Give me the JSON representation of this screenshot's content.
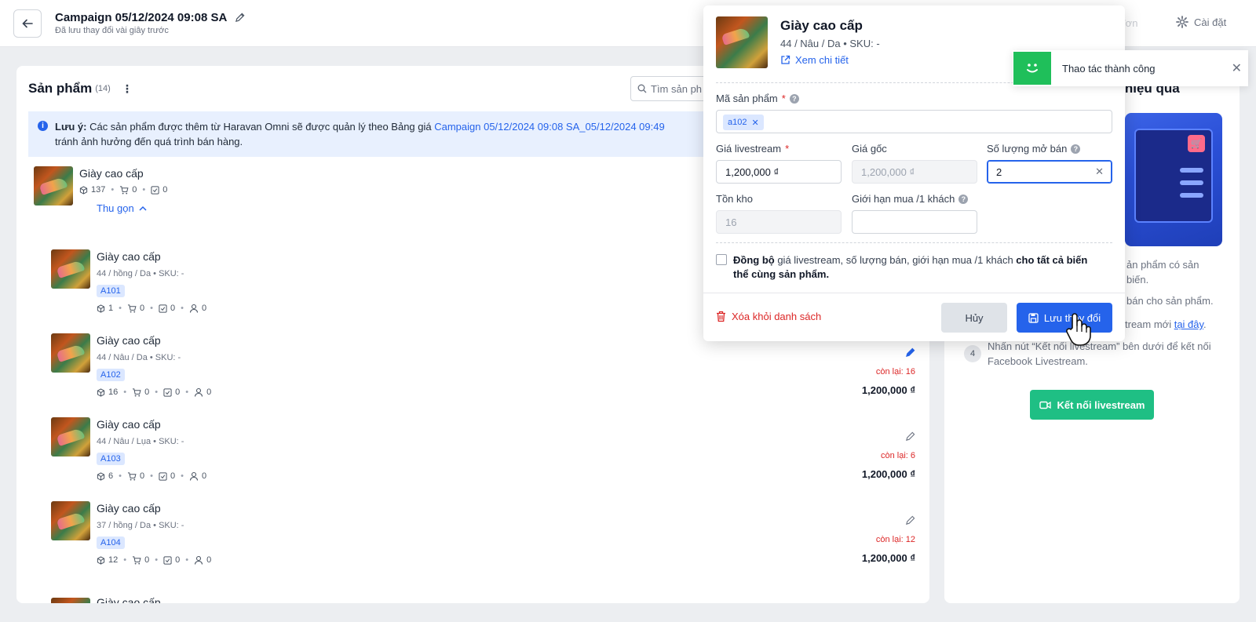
{
  "header": {
    "title": "Campaign 05/12/2024 09:08 SA",
    "subtitle": "Đã lưu thay đổi vài giây trước",
    "faded_action": "ết đơn",
    "settings_label": "Cài đặt"
  },
  "products_panel": {
    "title": "Sản phẩm",
    "count": "(14)",
    "search_placeholder": "Tìm sản ph",
    "notice": {
      "label": "Lưu ý:",
      "text": " Các sản phẩm được thêm từ Haravan Omni sẽ được quản lý theo Bảng giá ",
      "campaign_link": "Campaign 05/12/2024 09:08 SA_05/12/2024 09:49",
      "text2": "tránh ảnh hưởng đến quá trình bán hàng."
    },
    "parent": {
      "name": "Giày cao cấp",
      "stock": "137",
      "cart": "0",
      "ordered": "0",
      "collapse_label": "Thu gọn"
    },
    "variants": [
      {
        "name": "Giày cao cấp",
        "variant": "44 / hồng / Da • SKU: -",
        "tag": "A101",
        "stock": "1",
        "cart": "0",
        "ordered": "0",
        "buyers": "0",
        "remain": "",
        "price": ""
      },
      {
        "name": "Giày cao cấp",
        "variant": "44 / Nâu / Da • SKU: -",
        "tag": "A102",
        "stock": "16",
        "cart": "0",
        "ordered": "0",
        "buyers": "0",
        "remain": "còn lại: 16",
        "price": "1,200,000 ₫"
      },
      {
        "name": "Giày cao cấp",
        "variant": "44 / Nâu / Lụa • SKU: -",
        "tag": "A103",
        "stock": "6",
        "cart": "0",
        "ordered": "0",
        "buyers": "0",
        "remain": "còn lại: 6",
        "price": "1,200,000 ₫"
      },
      {
        "name": "Giày cao cấp",
        "variant": "37 / hồng / Da • SKU: -",
        "tag": "A104",
        "stock": "12",
        "cart": "0",
        "ordered": "0",
        "buyers": "0",
        "remain": "còn lại: 12",
        "price": "1,200,000 ₫"
      }
    ],
    "partial_next": "Giày cao cấp"
  },
  "guide": {
    "title": "m hiệu qua",
    "line1": "ản phẩm có sản",
    "line1b": "biến.",
    "line2": "bán cho sản phẩm.",
    "line3": "tream mới ",
    "line3_link": "tại đây",
    "line3_end": ".",
    "step4_num": "4",
    "step4_text": "Nhấn nút “Kết nối livestream” bên dưới để kết nối Facebook Livestream.",
    "connect_label": "Kết nối livestream"
  },
  "toast": {
    "message": "Thao tác thành công"
  },
  "edit_popover": {
    "name": "Giày cao cấp",
    "variant": "44 / Nâu / Da • SKU: -",
    "detail_link": "Xem chi tiết",
    "code_label": "Mã sản phẩm",
    "code_chip": "a102",
    "live_price_label": "Giá livestream",
    "live_price": "1,200,000 ₫",
    "orig_price_label": "Giá gốc",
    "orig_price": "1,200,000 ₫",
    "open_qty_label": "Số lượng mở bán",
    "open_qty": "2",
    "stock_label": "Tồn kho",
    "stock": "16",
    "limit_label": "Giới hạn mua /1 khách",
    "limit": "",
    "sync_bold1": "Đồng bộ",
    "sync_text": " giá livestream, số lượng bán, giới hạn mua /1 khách ",
    "sync_bold2": "cho tất cả biến thể cùng sản phẩm.",
    "delete_label": "Xóa khỏi danh sách",
    "cancel_label": "Hủy",
    "save_label": "Lưu thay đổi"
  },
  "colors": {
    "primary": "#2563eb",
    "success": "#1fbf84",
    "danger": "#dc2626"
  }
}
